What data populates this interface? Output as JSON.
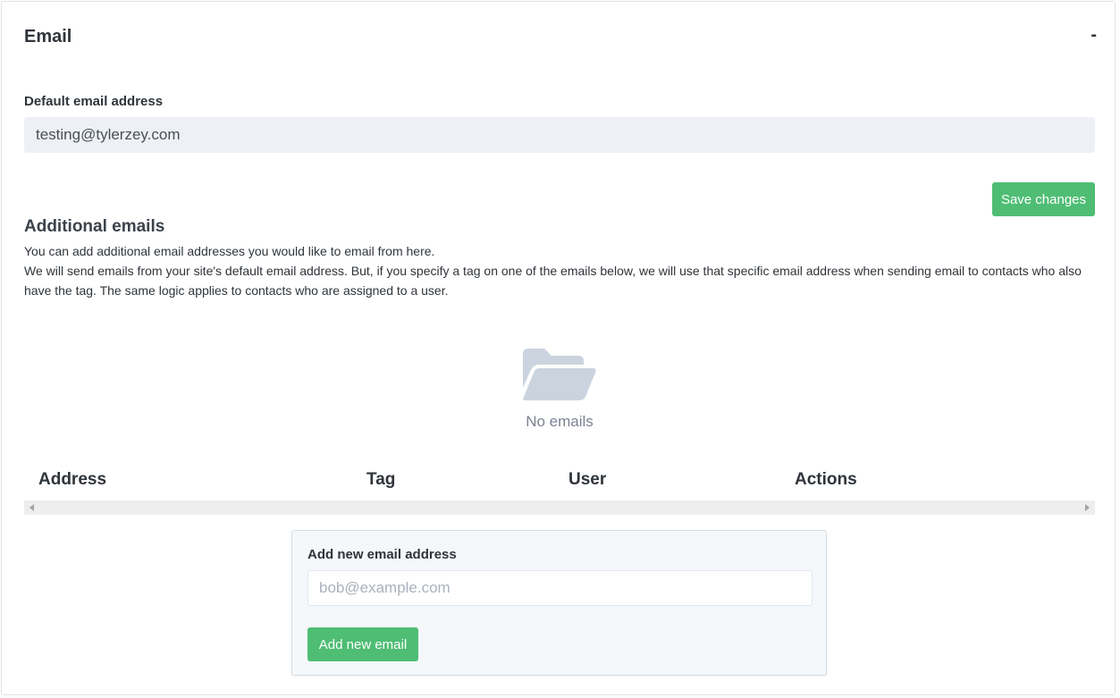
{
  "card": {
    "title": "Email",
    "collapse_symbol": "-"
  },
  "default_email": {
    "label": "Default email address",
    "value": "testing@tylerzey.com"
  },
  "save_button": "Save changes",
  "additional": {
    "title": "Additional emails",
    "desc_line1": "You can add additional email addresses you would like to email from here.",
    "desc_line2": "We will send emails from your site's default email address. But, if you specify a tag on one of the emails below, we will use that specific email address when sending email to contacts who also have the tag. The same logic applies to contacts who are assigned to a user."
  },
  "empty_state": {
    "icon": "folder-open-icon",
    "text": "No emails"
  },
  "table": {
    "headers": [
      "Address",
      "Tag",
      "User",
      "Actions"
    ]
  },
  "add_form": {
    "label": "Add new email address",
    "placeholder": "bob@example.com",
    "button": "Add new email"
  },
  "colors": {
    "accent_green": "#4fbd74",
    "input_bg": "#edf1f5",
    "icon_gray": "#cbd4de"
  }
}
